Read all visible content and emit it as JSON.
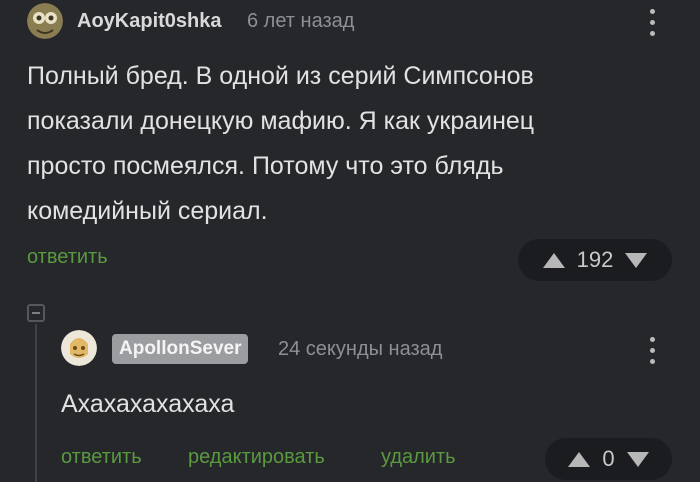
{
  "comment1": {
    "username": "AoyKapit0shka",
    "time": "6 лет назад",
    "lines": [
      "Полный бред. В одной из серий Симпсонов",
      "показали донецкую мафию. Я как украинец",
      "просто посмеялся. Потому что это блядь",
      "комедийный сериал."
    ],
    "reply_label": "ответить",
    "rating": "192"
  },
  "comment2": {
    "username": "ApollonSever",
    "time": "24 секунды назад",
    "text": "Ахахахахахаха",
    "reply_label": "ответить",
    "edit_label": "редактировать",
    "delete_label": "удалить",
    "rating": "0"
  },
  "colors": {
    "background": "#25272b",
    "action_green": "#5a9a3e",
    "username_tag_bg": "#9c9da1"
  }
}
